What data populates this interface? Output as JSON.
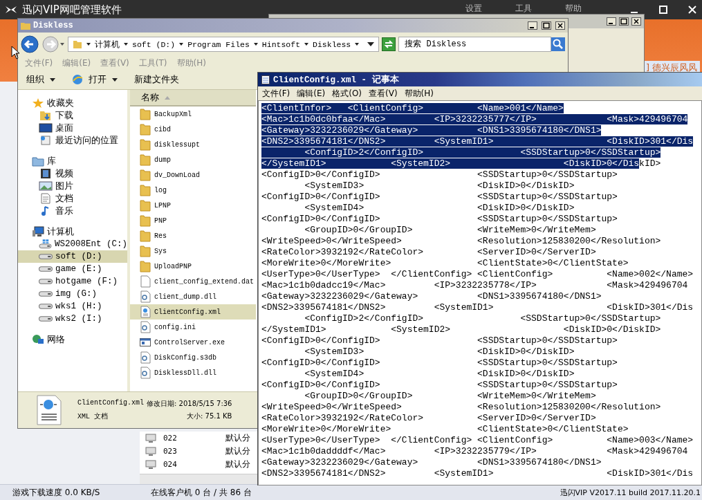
{
  "app": {
    "title": "迅闪VIP网吧管理软件",
    "menu": [
      "设置",
      "工具",
      "帮助"
    ],
    "side_text": "] 德兴辰风风"
  },
  "back_rows": [
    {
      "id": "022",
      "group": "默认分"
    },
    {
      "id": "023",
      "group": "默认分"
    },
    {
      "id": "024",
      "group": "默认分"
    }
  ],
  "status_bar": [
    "游戏下载速度 0.0 KB/S",
    "在线客户机 0 台 / 共 86 台",
    "迅闪VIP V2017.11 build 2017.11.20.1"
  ],
  "explorer": {
    "title": "Diskless",
    "breadcrumb": [
      "计算机",
      "soft (D:)",
      "Program Files",
      "Hintsoft",
      "Diskless"
    ],
    "search_placeholder": "搜索 Diskless",
    "menu": [
      "文件(F)",
      "编辑(E)",
      "查看(V)",
      "工具(T)",
      "帮助(H)"
    ],
    "toolbar": [
      {
        "label": "组织",
        "kind": "dropdown"
      },
      {
        "label": "打开",
        "kind": "open"
      },
      {
        "label": "新建文件夹",
        "kind": "plain"
      }
    ],
    "nav": [
      {
        "label": "收藏夹",
        "kind": "favorites",
        "items": [
          {
            "label": "下载",
            "kind": "download",
            "selected": false
          },
          {
            "label": "桌面",
            "kind": "desktop",
            "selected": false
          },
          {
            "label": "最近访问的位置",
            "kind": "recent",
            "selected": false
          }
        ]
      },
      {
        "label": "库",
        "kind": "library",
        "items": [
          {
            "label": "视频",
            "kind": "video",
            "selected": false
          },
          {
            "label": "图片",
            "kind": "picture",
            "selected": false
          },
          {
            "label": "文档",
            "kind": "document",
            "selected": false
          },
          {
            "label": "音乐",
            "kind": "music",
            "selected": false
          }
        ]
      },
      {
        "label": "计算机",
        "kind": "computer",
        "items": [
          {
            "label": "WS2008Ent (C:)",
            "kind": "system",
            "selected": false
          },
          {
            "label": "soft (D:)",
            "kind": "drive",
            "selected": true
          },
          {
            "label": "game (E:)",
            "kind": "drive",
            "selected": false
          },
          {
            "label": "hotgame (F:)",
            "kind": "drive",
            "selected": false
          },
          {
            "label": "img (G:)",
            "kind": "drive",
            "selected": false
          },
          {
            "label": "wks1 (H:)",
            "kind": "drive",
            "selected": false
          },
          {
            "label": "wks2 (I:)",
            "kind": "drive",
            "selected": false
          }
        ]
      },
      {
        "label": "网络",
        "kind": "network"
      }
    ],
    "column": "名称",
    "files": [
      {
        "name": "BackupXml",
        "kind": "folder",
        "selected": false
      },
      {
        "name": "cibd",
        "kind": "folder",
        "selected": false
      },
      {
        "name": "disklessupt",
        "kind": "folder",
        "selected": false
      },
      {
        "name": "dump",
        "kind": "folder",
        "selected": false
      },
      {
        "name": "dv_DownLoad",
        "kind": "folder",
        "selected": false
      },
      {
        "name": "log",
        "kind": "folder",
        "selected": false
      },
      {
        "name": "LPNP",
        "kind": "folder",
        "selected": false
      },
      {
        "name": "PNP",
        "kind": "folder",
        "selected": false
      },
      {
        "name": "Res",
        "kind": "folder",
        "selected": false
      },
      {
        "name": "Sys",
        "kind": "folder",
        "selected": false
      },
      {
        "name": "UploadPNP",
        "kind": "folder",
        "selected": false
      },
      {
        "name": "client_config_extend.dat",
        "kind": "file",
        "selected": false
      },
      {
        "name": "client_dump.dll",
        "kind": "dll",
        "selected": false
      },
      {
        "name": "ClientConfig.xml",
        "kind": "xml",
        "selected": true
      },
      {
        "name": "config.ini",
        "kind": "ini",
        "selected": false
      },
      {
        "name": "ControlServer.exe",
        "kind": "exe",
        "selected": false
      },
      {
        "name": "DiskConfig.s3db",
        "kind": "dll",
        "selected": false
      },
      {
        "name": "DisklessDll.dll",
        "kind": "dll",
        "selected": false
      }
    ],
    "details": {
      "name": "ClientConfig.xml",
      "modified": "修改日期: 2018/5/15 7:36",
      "type": "XML 文档",
      "size": "大小: 75.1 KB"
    }
  },
  "notepad": {
    "title": "ClientConfig.xml - 记事本",
    "menu": [
      "文件(F)",
      "编辑(E)",
      "格式(O)",
      "查看(V)",
      "帮助(H)"
    ],
    "lines": [
      {
        "segments": [
          {
            "text": "<ClientInfor>   <ClientConfig>          <Name>001</Name>",
            "selected": true
          }
        ]
      },
      {
        "segments": [
          {
            "text": "<Mac>1c1b0dc0bfaa</Mac>         <IP>3232235777</IP>             <Mask>429496704",
            "selected": true
          }
        ]
      },
      {
        "segments": [
          {
            "text": "<Gateway>3232236029</Gateway>           <DNS1>3395674180</DNS1>",
            "selected": true
          }
        ]
      },
      {
        "segments": [
          {
            "text": "<DNS2>3395674181</DNS2>         <SystemID1>                     <DiskID>301</Dis",
            "selected": true
          }
        ]
      },
      {
        "segments": [
          {
            "text": "        <ConfigID>2</ConfigID>                  <SSDStartup>0</SSDStartup>",
            "selected": true
          }
        ]
      },
      {
        "segments": [
          {
            "text": "</SystemID1>            <SystemID2>                     <DiskID>0</Dis",
            "selected": true
          },
          {
            "text": "kID>",
            "selected": false
          }
        ]
      },
      {
        "segments": [
          {
            "text": "<ConfigID>0</ConfigID>                  <SSDStartup>0</SSDStartup>",
            "selected": false
          }
        ]
      },
      {
        "segments": [
          {
            "text": "        <SystemID3>                     <DiskID>0</DiskID>",
            "selected": false
          }
        ]
      },
      {
        "segments": [
          {
            "text": "<ConfigID>0</ConfigID>                  <SSDStartup>0</SSDStartup>",
            "selected": false
          }
        ]
      },
      {
        "segments": [
          {
            "text": "        <SystemID4>                     <DiskID>0</DiskID>",
            "selected": false
          }
        ]
      },
      {
        "segments": [
          {
            "text": "<ConfigID>0</ConfigID>                  <SSDStartup>0</SSDStartup>",
            "selected": false
          }
        ]
      },
      {
        "segments": [
          {
            "text": "        <GroupID>0</GroupID>            <WriteMem>0</WriteMem>",
            "selected": false
          }
        ]
      },
      {
        "segments": [
          {
            "text": "<WriteSpeed>0</WriteSpeed>              <Resolution>125830200</Resolution>",
            "selected": false
          }
        ]
      },
      {
        "segments": [
          {
            "text": "<RateColor>3932192</RateColor>          <ServerID>0</ServerID>",
            "selected": false
          }
        ]
      },
      {
        "segments": [
          {
            "text": "<MoreWrite>0</MoreWrite>                <ClientState>0</ClientState>",
            "selected": false
          }
        ]
      },
      {
        "segments": [
          {
            "text": "<UserType>0</UserType>  </ClientConfig> <ClientConfig>          <Name>002</Name>",
            "selected": false
          }
        ]
      },
      {
        "segments": [
          {
            "text": "<Mac>1c1b0dadcc19</Mac>         <IP>3232235778</IP>             <Mask>429496704",
            "selected": false
          }
        ]
      },
      {
        "segments": [
          {
            "text": "<Gateway>3232236029</Gateway>           <DNS1>3395674180</DNS1>",
            "selected": false
          }
        ]
      },
      {
        "segments": [
          {
            "text": "<DNS2>3395674181</DNS2>         <SystemID1>                     <DiskID>301</Dis",
            "selected": false
          }
        ]
      },
      {
        "segments": [
          {
            "text": "        <ConfigID>2</ConfigID>                  <SSDStartup>0</SSDStartup>",
            "selected": false
          }
        ]
      },
      {
        "segments": [
          {
            "text": "</SystemID1>            <SystemID2>                     <DiskID>0</DiskID>",
            "selected": false
          }
        ]
      },
      {
        "segments": [
          {
            "text": "<ConfigID>0</ConfigID>                  <SSDStartup>0</SSDStartup>",
            "selected": false
          }
        ]
      },
      {
        "segments": [
          {
            "text": "        <SystemID3>                     <DiskID>0</DiskID>",
            "selected": false
          }
        ]
      },
      {
        "segments": [
          {
            "text": "<ConfigID>0</ConfigID>                  <SSDStartup>0</SSDStartup>",
            "selected": false
          }
        ]
      },
      {
        "segments": [
          {
            "text": "        <SystemID4>                     <DiskID>0</DiskID>",
            "selected": false
          }
        ]
      },
      {
        "segments": [
          {
            "text": "<ConfigID>0</ConfigID>                  <SSDStartup>0</SSDStartup>",
            "selected": false
          }
        ]
      },
      {
        "segments": [
          {
            "text": "        <GroupID>0</GroupID>            <WriteMem>0</WriteMem>",
            "selected": false
          }
        ]
      },
      {
        "segments": [
          {
            "text": "<WriteSpeed>0</WriteSpeed>              <Resolution>125830200</Resolution>",
            "selected": false
          }
        ]
      },
      {
        "segments": [
          {
            "text": "<RateColor>3932192</RateColor>          <ServerID>0</ServerID>",
            "selected": false
          }
        ]
      },
      {
        "segments": [
          {
            "text": "<MoreWrite>0</MoreWrite>                <ClientState>0</ClientState>",
            "selected": false
          }
        ]
      },
      {
        "segments": [
          {
            "text": "<UserType>0</UserType>  </ClientConfig> <ClientConfig>          <Name>003</Name>",
            "selected": false
          }
        ]
      },
      {
        "segments": [
          {
            "text": "<Mac>1c1b0daddddf</Mac>         <IP>3232235779</IP>             <Mask>429496704",
            "selected": false
          }
        ]
      },
      {
        "segments": [
          {
            "text": "<Gateway>3232236029</Gateway>           <DNS1>3395674180</DNS1>",
            "selected": false
          }
        ]
      },
      {
        "segments": [
          {
            "text": "<DNS2>3395674181</DNS2>         <SystemID1>                     <DiskID>301</Dis",
            "selected": false
          }
        ]
      }
    ]
  }
}
